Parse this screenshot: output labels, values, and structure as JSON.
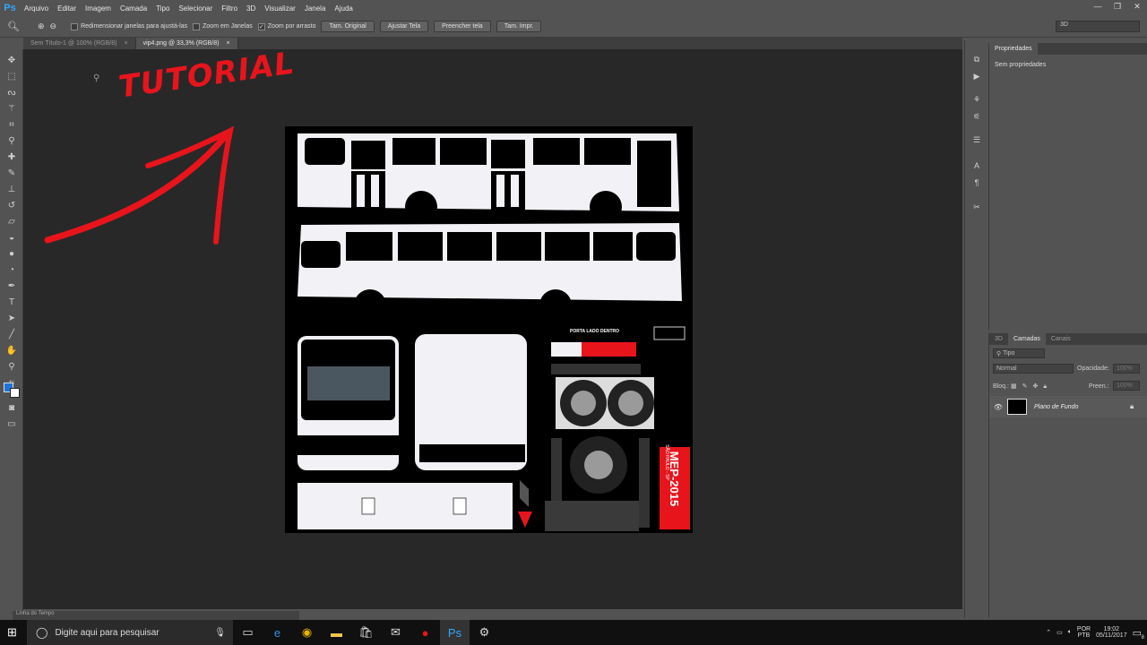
{
  "app": {
    "logo": "Ps",
    "menu": [
      "Arquivo",
      "Editar",
      "Imagem",
      "Camada",
      "Tipo",
      "Selecionar",
      "Filtro",
      "3D",
      "Visualizar",
      "Janela",
      "Ajuda"
    ],
    "window_controls": [
      "—",
      "❐",
      "✕"
    ]
  },
  "options": {
    "resize_label": "Redimensionar janelas para ajustá-las",
    "zoom_all_label": "Zoom em Janelas",
    "scrubby_label": "Zoom por arrasto",
    "buttons": [
      "Tam. Original",
      "Ajustar Tela",
      "Preencher tela",
      "Tam. Impr."
    ],
    "workspace": "3D"
  },
  "tabs": [
    {
      "label": "Sem Título-1 @ 100% (RGB/8)",
      "close": "×"
    },
    {
      "label": "vip4.png @ 33,3% (RGB/8)",
      "close": "×"
    }
  ],
  "annotation": {
    "text": "TUTORIAL"
  },
  "texture": {
    "door_label": "PORTA LADO DENTRO",
    "plate_text": "MEP-2015",
    "plate_sub": "SÃO PAULO - SP",
    "accent": "#e8141c"
  },
  "properties_panel": {
    "tab": "Propriedades",
    "empty_text": "Sem propriedades"
  },
  "layers_panel": {
    "tabs": [
      "3D",
      "Camadas",
      "Canais"
    ],
    "filter": "Tipo",
    "blend_mode": "Normal",
    "opacity_label": "Opacidade:",
    "opacity_value": "100%",
    "lock_label": "Bloq.:",
    "fill_label": "Preen.:",
    "fill_value": "100%",
    "layer_name": "Plano de Fundo"
  },
  "timeline": {
    "label": "Linha do Tempo"
  },
  "taskbar": {
    "search_placeholder": "Digite aqui para pesquisar",
    "lang_top": "POR",
    "lang_bottom": "PTB",
    "time": "19:02",
    "date": "05/11/2017",
    "notif_count": "8"
  }
}
